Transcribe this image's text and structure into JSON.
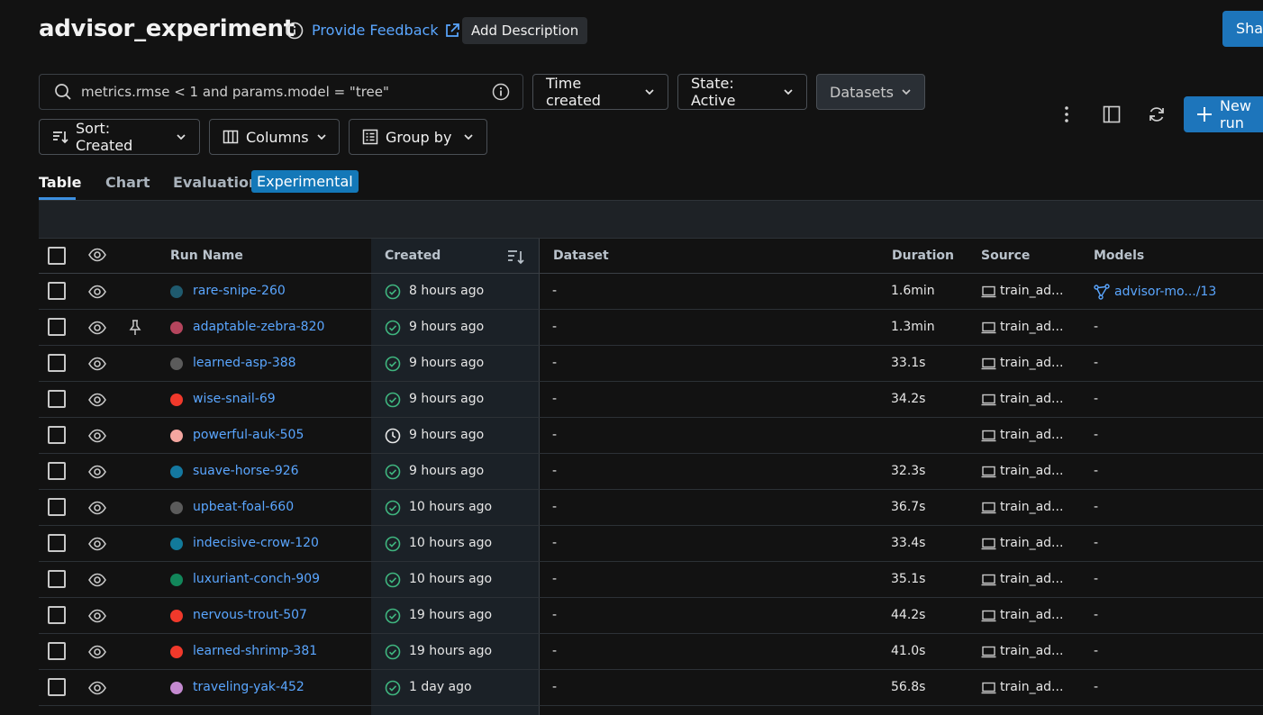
{
  "header": {
    "title": "advisor_experiment",
    "feedback_label": "Provide Feedback",
    "add_description_label": "Add Description",
    "share_label": "Share"
  },
  "toolbar": {
    "search_value": "metrics.rmse < 1 and params.model = \"tree\"",
    "time_created_label": "Time created",
    "state_label": "State: Active",
    "datasets_label": "Datasets",
    "sort_label": "Sort: Created",
    "columns_label": "Columns",
    "group_by_label": "Group by",
    "new_run_label": "New run"
  },
  "tabs": {
    "table": "Table",
    "chart": "Chart",
    "evaluation": "Evaluation",
    "experimental_badge": "Experimental"
  },
  "columns": {
    "run_name": "Run Name",
    "created": "Created",
    "dataset": "Dataset",
    "duration": "Duration",
    "source": "Source",
    "models": "Models"
  },
  "colors": {
    "accent": "#1d75bb",
    "link": "#5aa6ff",
    "status_ok": "#3fb57f"
  },
  "rows": [
    {
      "name": "rare-snipe-260",
      "color": "#1f5a6e",
      "status": "finished",
      "created": "8 hours ago",
      "dataset": "-",
      "duration": "1.6min",
      "source": "train_ad...",
      "model": "advisor-mo.../13",
      "model_link": true,
      "pinned": false
    },
    {
      "name": "adaptable-zebra-820",
      "color": "#b5455d",
      "status": "finished",
      "created": "9 hours ago",
      "dataset": "-",
      "duration": "1.3min",
      "source": "train_ad...",
      "model": "-",
      "model_link": false,
      "pinned": true
    },
    {
      "name": "learned-asp-388",
      "color": "#5b5b5b",
      "status": "finished",
      "created": "9 hours ago",
      "dataset": "-",
      "duration": "33.1s",
      "source": "train_ad...",
      "model": "-",
      "model_link": false,
      "pinned": false
    },
    {
      "name": "wise-snail-69",
      "color": "#f0392b",
      "status": "finished",
      "created": "9 hours ago",
      "dataset": "-",
      "duration": "34.2s",
      "source": "train_ad...",
      "model": "-",
      "model_link": false,
      "pinned": false
    },
    {
      "name": "powerful-auk-505",
      "color": "#f4a6a0",
      "status": "running",
      "created": "9 hours ago",
      "dataset": "-",
      "duration": "",
      "source": "train_ad...",
      "model": "-",
      "model_link": false,
      "pinned": false
    },
    {
      "name": "suave-horse-926",
      "color": "#1478a0",
      "status": "finished",
      "created": "9 hours ago",
      "dataset": "-",
      "duration": "32.3s",
      "source": "train_ad...",
      "model": "-",
      "model_link": false,
      "pinned": false
    },
    {
      "name": "upbeat-foal-660",
      "color": "#5b5b5b",
      "status": "finished",
      "created": "10 hours ago",
      "dataset": "-",
      "duration": "36.7s",
      "source": "train_ad...",
      "model": "-",
      "model_link": false,
      "pinned": false
    },
    {
      "name": "indecisive-crow-120",
      "color": "#127a9a",
      "status": "finished",
      "created": "10 hours ago",
      "dataset": "-",
      "duration": "33.4s",
      "source": "train_ad...",
      "model": "-",
      "model_link": false,
      "pinned": false
    },
    {
      "name": "luxuriant-conch-909",
      "color": "#12865a",
      "status": "finished",
      "created": "10 hours ago",
      "dataset": "-",
      "duration": "35.1s",
      "source": "train_ad...",
      "model": "-",
      "model_link": false,
      "pinned": false
    },
    {
      "name": "nervous-trout-507",
      "color": "#f0392b",
      "status": "finished",
      "created": "19 hours ago",
      "dataset": "-",
      "duration": "44.2s",
      "source": "train_ad...",
      "model": "-",
      "model_link": false,
      "pinned": false
    },
    {
      "name": "learned-shrimp-381",
      "color": "#f0392b",
      "status": "finished",
      "created": "19 hours ago",
      "dataset": "-",
      "duration": "41.0s",
      "source": "train_ad...",
      "model": "-",
      "model_link": false,
      "pinned": false
    },
    {
      "name": "traveling-yak-452",
      "color": "#c48ad0",
      "status": "finished",
      "created": "1 day ago",
      "dataset": "-",
      "duration": "56.8s",
      "source": "train_ad...",
      "model": "-",
      "model_link": false,
      "pinned": false
    }
  ]
}
